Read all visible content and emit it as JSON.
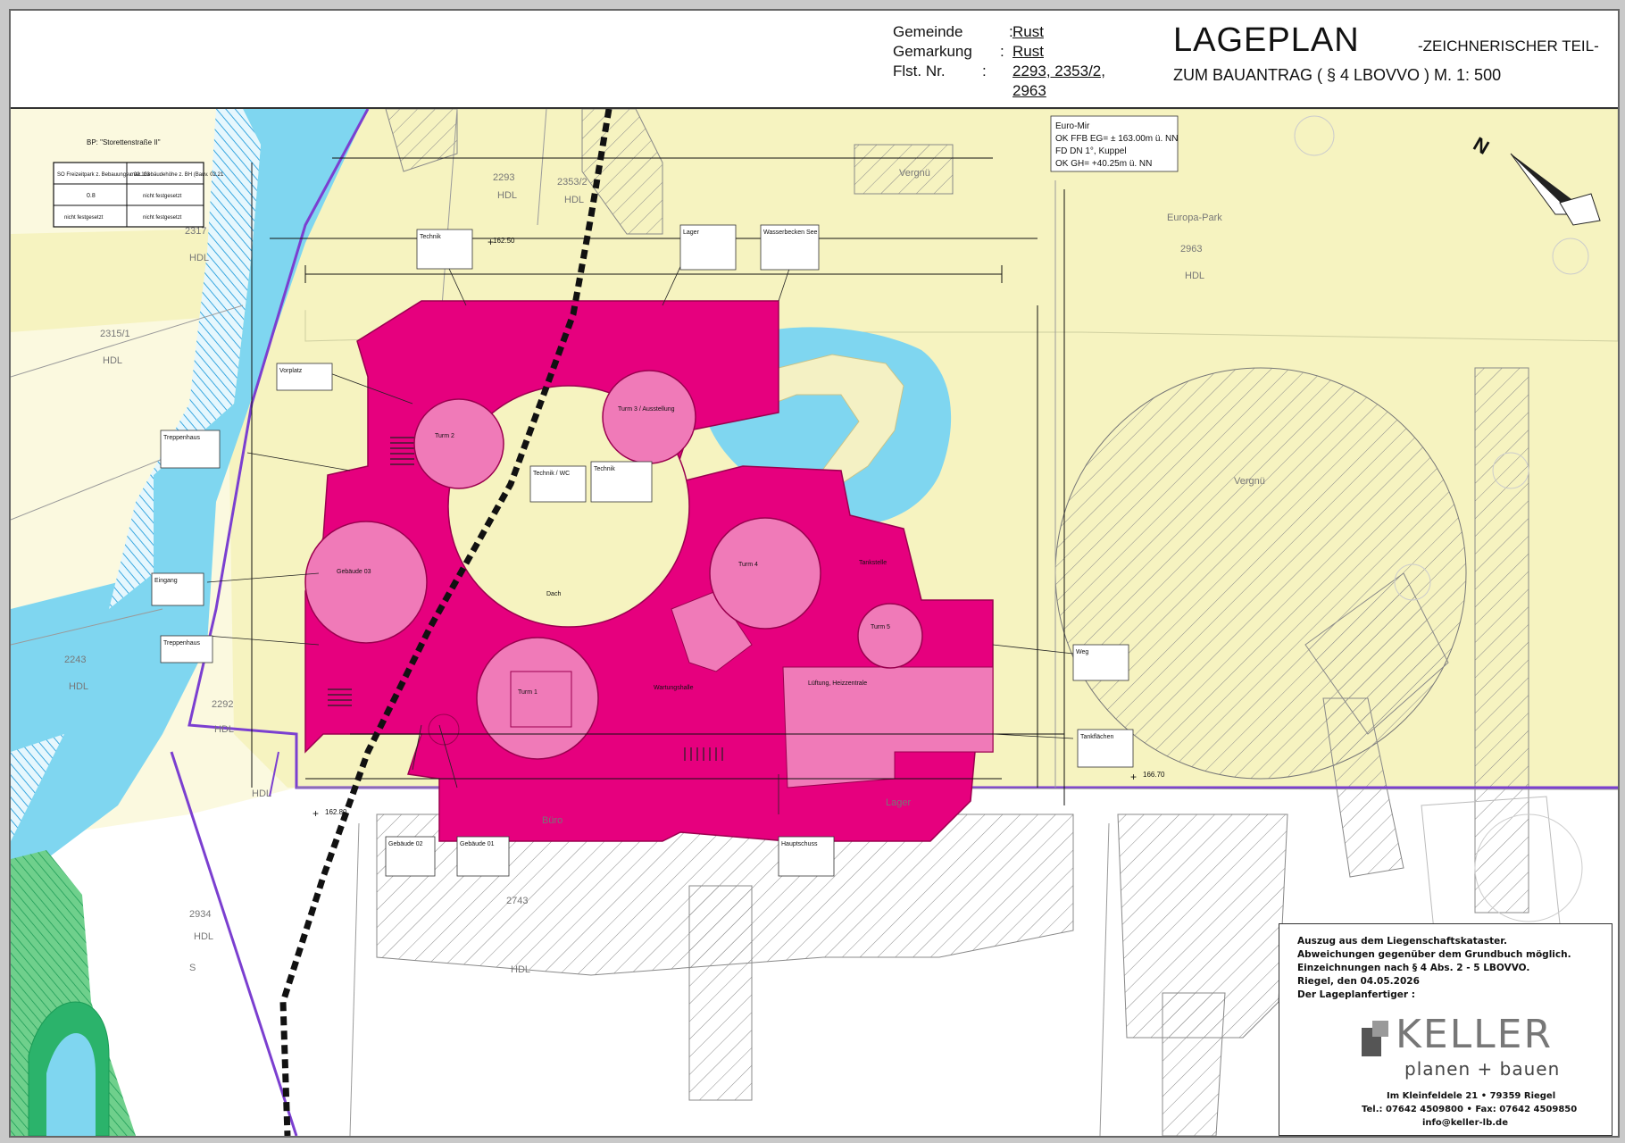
{
  "header": {
    "gemeinde_label": "Gemeinde",
    "gemeinde_value": "Rust",
    "gemarkung_label": "Gemarkung",
    "gemarkung_value": "Rust",
    "flst_label": "Flst. Nr.",
    "flst_value_1": "2293, 2353/2,",
    "flst_value_2": "2963",
    "colon": ":",
    "title": "LAGEPLAN",
    "subtitle": "ZUM BAUANTRAG  ( § 4  LBOVVO )  M.  1: 500",
    "part": "-ZEICHNERISCHER TEIL-"
  },
  "legend_table": {
    "caption": "BP: \"Storettenstraße II\"",
    "col1": "SO Freizeitpark z. Bebauungsv. 02.113",
    "col2": "max. Gebäudehöhe z. BH (Bauv. 02.21",
    "r1c1": "0.8",
    "r1c2": "nicht festgesetzt",
    "r2c1": "nicht festgesetzt",
    "r2c2": "nicht festgesetzt"
  },
  "info_box": {
    "l1": "Euro-Mir",
    "l2": "OK FFB EG= ± 163.00m ü. NN",
    "l3": "FD DN 1°, Kuppel",
    "l4": "OK GH= +40.25m ü. NN"
  },
  "parcels": {
    "p2293": "2293",
    "p2353": "2353/2",
    "p2317": "2317",
    "p2315": "2315/1",
    "p2963": "2963",
    "p2243": "2243",
    "p2292": "2292",
    "p2743": "2743",
    "p2934": "2934",
    "hdl": "HDL",
    "europa_park": "Europa-Park",
    "s": "S",
    "buro": "Büro",
    "lager": "Lager",
    "vergn": "Vergnü"
  },
  "buildings": {
    "turm1": "Turm 1",
    "turm2": "Turm 2",
    "turm3": "Turm 3 / Ausstellung",
    "turm4": "Turm 4",
    "turm5": "Turm 5",
    "geb03": "Gebäude 03",
    "gruen": "Dach",
    "wartung": "Wartungshalle",
    "lueftung": "Lüftung, Heizzentrale",
    "technik": "Technik / WC",
    "lager": "Lager",
    "eingang": "Eingang",
    "treppe": "Treppenhaus",
    "tankstelle": "Tankstelle"
  },
  "labels": {
    "technik_box": "Technik",
    "lager_box": "Lager",
    "wasser_box": "Wasserbecken See",
    "vorplatz_box": "Vorplatz",
    "treppenhaus_box": "Treppenhaus",
    "eingang_box": "Eingang",
    "treppenhaus2_box": "Treppenhaus",
    "gebaeude02_box": "Gebäude 02",
    "gebaeude01_box": "Gebäude 01",
    "hauptschuss_box": "Hauptschuss",
    "weg_box": "Weg",
    "tankstelle_box": "Tankflächen",
    "tech_wc_box": "Technik / WC",
    "technik2_box": "Technik",
    "spot1": "162.50",
    "spot2": "162.80",
    "spot3": "166.70"
  },
  "stamp": {
    "n1": "Auszug aus dem Liegenschaftskataster.",
    "n2": "Abweichungen gegenüber dem Grundbuch möglich.",
    "n3": "Einzeichnungen nach  § 4  Abs. 2 - 5 LBOVVO.",
    "n4": "Riegel, den 04.05.2026",
    "n5": "Der Lageplanfertiger :",
    "logo": "KELLER",
    "logo_sub": "planen + bauen",
    "addr1": "Im Kleinfeldele 21 • 79359 Riegel",
    "addr2": "Tel.: 07642 4509800 • Fax: 07642 4509850",
    "addr3": "info@keller-lb.de"
  },
  "colors": {
    "yellow": "#f6f3c0",
    "water": "#7fd6f0",
    "building_magenta": "#e6007e",
    "building_pink": "#f07ab8",
    "boundary": "#7b3fd0",
    "green": "#2bb36b"
  }
}
